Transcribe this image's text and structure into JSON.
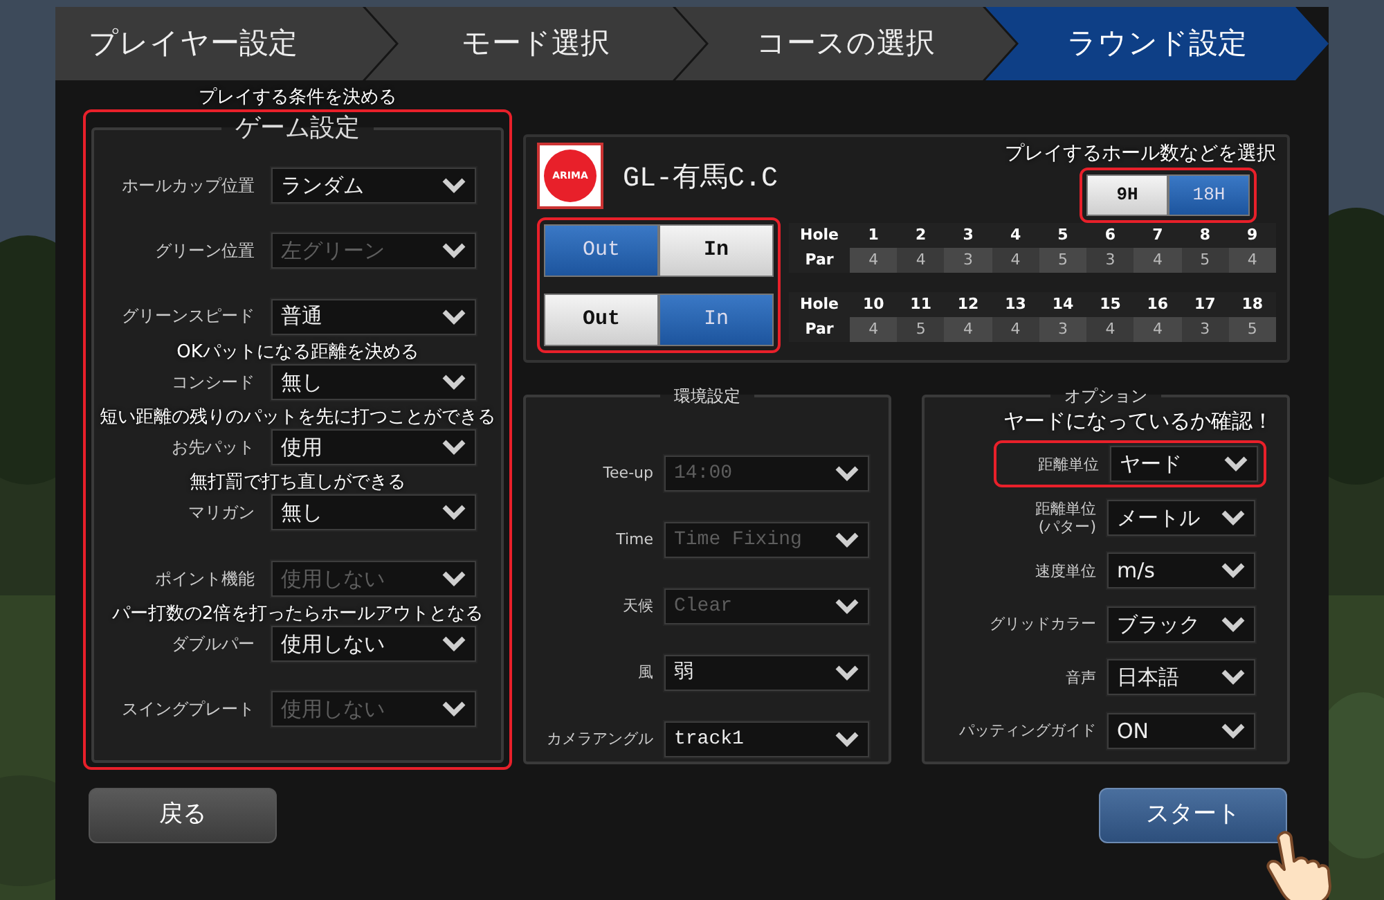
{
  "steps": [
    {
      "label": "プレイヤー設定",
      "selected": false
    },
    {
      "label": "モード選択",
      "selected": false
    },
    {
      "label": "コースの選択",
      "selected": false
    },
    {
      "label": "ラウンド設定",
      "selected": true
    }
  ],
  "game_settings": {
    "note": "プレイする条件を決める",
    "title": "ゲーム設定",
    "highlighted": true,
    "rows": [
      {
        "label": "ホールカップ位置",
        "value": "ランダム",
        "disabled": false
      },
      {
        "label": "グリーン位置",
        "value": "左グリーン",
        "disabled": true
      },
      {
        "label": "グリーンスピード",
        "value": "普通",
        "disabled": false
      },
      {
        "note": "OKパットになる距離を決める",
        "label": "コンシード",
        "value": "無し",
        "disabled": false
      },
      {
        "note": "短い距離の残りのパットを先に打つことができる",
        "label": "お先パット",
        "value": "使用",
        "disabled": false
      },
      {
        "note": "無打罰で打ち直しができる",
        "label": "マリガン",
        "value": "無し",
        "disabled": false
      },
      {
        "label": "ポイント機能",
        "value": "使用しない",
        "disabled": true
      },
      {
        "note": "パー打数の2倍を打ったらホールアウトとなる",
        "label": "ダブルパー",
        "value": "使用しない",
        "disabled": false
      },
      {
        "label": "スイングプレート",
        "value": "使用しない",
        "disabled": true
      }
    ]
  },
  "course": {
    "logo_text": "ARIMA",
    "name": "GL-有馬C.C",
    "note": "プレイするホール数などを選択",
    "hole_count": {
      "highlighted": true,
      "options": [
        {
          "label": "9H",
          "selected": false
        },
        {
          "label": "18H",
          "selected": true
        }
      ]
    },
    "halves_highlighted": true,
    "halves": [
      {
        "toggle": [
          {
            "label": "Out",
            "selected": true
          },
          {
            "label": "In",
            "selected": false
          }
        ],
        "hole_label": "Hole",
        "par_label": "Par",
        "holes": [
          {
            "number": "1",
            "par": "4"
          },
          {
            "number": "2",
            "par": "4"
          },
          {
            "number": "3",
            "par": "3"
          },
          {
            "number": "4",
            "par": "4"
          },
          {
            "number": "5",
            "par": "5"
          },
          {
            "number": "6",
            "par": "3"
          },
          {
            "number": "7",
            "par": "4"
          },
          {
            "number": "8",
            "par": "5"
          },
          {
            "number": "9",
            "par": "4"
          }
        ]
      },
      {
        "toggle": [
          {
            "label": "Out",
            "selected": false
          },
          {
            "label": "In",
            "selected": true
          }
        ],
        "hole_label": "Hole",
        "par_label": "Par",
        "holes": [
          {
            "number": "10",
            "par": "4"
          },
          {
            "number": "11",
            "par": "5"
          },
          {
            "number": "12",
            "par": "4"
          },
          {
            "number": "13",
            "par": "4"
          },
          {
            "number": "14",
            "par": "3"
          },
          {
            "number": "15",
            "par": "4"
          },
          {
            "number": "16",
            "par": "4"
          },
          {
            "number": "17",
            "par": "3"
          },
          {
            "number": "18",
            "par": "5"
          }
        ]
      }
    ]
  },
  "environment": {
    "title": "環境設定",
    "rows": [
      {
        "label": "Tee-up",
        "value": "14:00",
        "disabled": true
      },
      {
        "label": "Time",
        "value": "Time Fixing",
        "disabled": true
      },
      {
        "label": "天候",
        "value": "Clear",
        "disabled": true
      },
      {
        "label": "風",
        "value": "弱",
        "disabled": false
      },
      {
        "label": "カメラアングル",
        "value": "track1",
        "disabled": false
      }
    ]
  },
  "options": {
    "title": "オプション",
    "note": "ヤードになっているか確認！",
    "rows": [
      {
        "label": "距離単位",
        "value": "ヤード",
        "disabled": false,
        "highlighted": true
      },
      {
        "label": "距離単位",
        "sublabel": "(パター)",
        "value": "メートル",
        "disabled": false,
        "highlighted": false
      },
      {
        "label": "速度単位",
        "value": "m/s",
        "disabled": false,
        "highlighted": false
      },
      {
        "label": "グリッドカラー",
        "value": "ブラック",
        "disabled": false,
        "highlighted": false
      },
      {
        "label": "音声",
        "value": "日本語",
        "disabled": false,
        "highlighted": false
      },
      {
        "label": "パッティングガイド",
        "value": "ON",
        "disabled": false,
        "highlighted": false
      }
    ]
  },
  "buttons": {
    "back": "戻る",
    "start": "スタート"
  }
}
